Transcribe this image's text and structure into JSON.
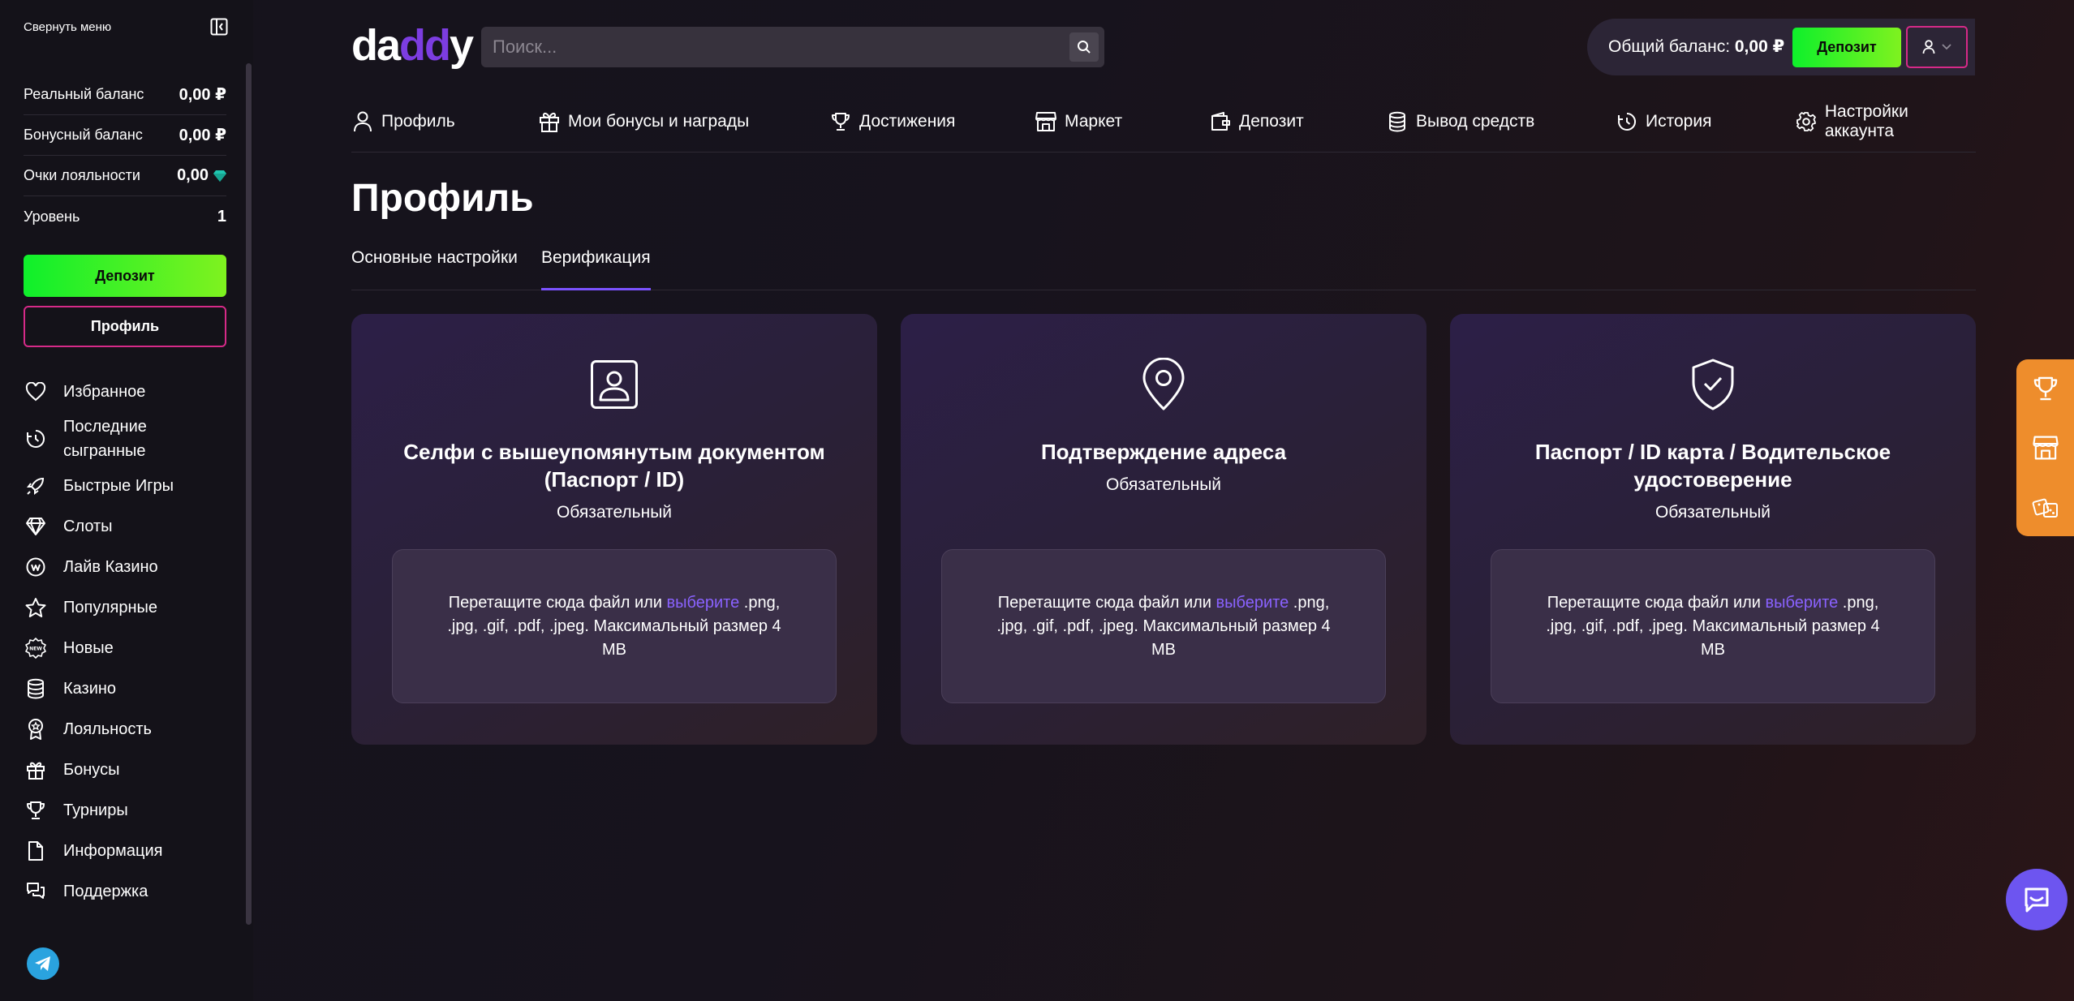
{
  "sidebar": {
    "collapse_label": "Свернуть меню",
    "stats": [
      {
        "label": "Реальный баланс",
        "value": "0,00 ₽"
      },
      {
        "label": "Бонусный баланс",
        "value": "0,00 ₽"
      },
      {
        "label": "Очки лояльности",
        "value": "0,00"
      },
      {
        "label": "Уровень",
        "value": "1"
      }
    ],
    "deposit_label": "Депозит",
    "profile_label": "Профиль",
    "items": [
      {
        "label": "Избранное",
        "icon": "heart-icon"
      },
      {
        "label": "Последние сыгранные",
        "icon": "recent-clock-icon"
      },
      {
        "label": "Быстрые Игры",
        "icon": "rocket-icon"
      },
      {
        "label": "Слоты",
        "icon": "diamond-icon"
      },
      {
        "label": "Лайв Казино",
        "icon": "live-casino-icon"
      },
      {
        "label": "Популярные",
        "icon": "star-icon"
      },
      {
        "label": "Новые",
        "icon": "new-badge-icon"
      },
      {
        "label": "Казино",
        "icon": "coins-icon"
      },
      {
        "label": "Лояльность",
        "icon": "medal-icon"
      },
      {
        "label": "Бонусы",
        "icon": "gift-icon"
      },
      {
        "label": "Турниры",
        "icon": "trophy-icon"
      },
      {
        "label": "Информация",
        "icon": "document-icon"
      },
      {
        "label": "Поддержка",
        "icon": "chat-bubbles-icon"
      }
    ]
  },
  "header": {
    "logo_text_a": "da",
    "logo_text_b": "dd",
    "logo_text_c": "y",
    "search_placeholder": "Поиск...",
    "balance_label": "Общий баланс:",
    "balance_value": "0,00 ₽",
    "deposit_label": "Депозит"
  },
  "topnav": [
    {
      "label": "Профиль",
      "icon": "user-icon"
    },
    {
      "label": "Мои бонусы и награды",
      "icon": "gift-icon"
    },
    {
      "label": "Достижения",
      "icon": "trophy-icon"
    },
    {
      "label": "Маркет",
      "icon": "shop-icon"
    },
    {
      "label": "Депозит",
      "icon": "wallet-icon"
    },
    {
      "label": "Вывод средств",
      "icon": "coins-icon"
    },
    {
      "label": "История",
      "icon": "history-icon"
    },
    {
      "label": "Настройки аккаунта",
      "icon": "gear-icon"
    }
  ],
  "page": {
    "title": "Профиль",
    "tabs": [
      "Основные настройки",
      "Верификация"
    ],
    "active_tab": "Верификация"
  },
  "cards": [
    {
      "title": "Селфи с вышеупомянутым документом (Паспорт / ID)",
      "subtitle": "Обязательный",
      "icon": "id-selfie-icon",
      "drop_before": "Перетащите сюда файл или ",
      "drop_link": "выберите",
      "drop_after": " .png, .jpg, .gif, .pdf, .jpeg. Максимальный размер 4 MB"
    },
    {
      "title": "Подтверждение адреса",
      "subtitle": "Обязательный",
      "icon": "location-pin-icon",
      "drop_before": "Перетащите сюда файл или ",
      "drop_link": "выберите",
      "drop_after": " .png, .jpg, .gif, .pdf, .jpeg. Максимальный размер 4 MB"
    },
    {
      "title": "Паспорт / ID карта / Водительское удостоверение",
      "subtitle": "Обязательный",
      "icon": "shield-check-icon",
      "drop_before": "Перетащите сюда файл или ",
      "drop_link": "выберите",
      "drop_after": " .png, .jpg, .gif, .pdf, .jpeg. Максимальный размер 4 MB"
    }
  ],
  "floating": {
    "items": [
      "trophy-icon",
      "shop-icon",
      "dice-icon"
    ],
    "accent": "#ee8d2c"
  },
  "colors": {
    "brand_purple": "#7c3de0",
    "link": "#8a62ff",
    "deposit_green": "#0ef02b",
    "profile_border": "#d62a88",
    "chat": "#6d55f0"
  }
}
